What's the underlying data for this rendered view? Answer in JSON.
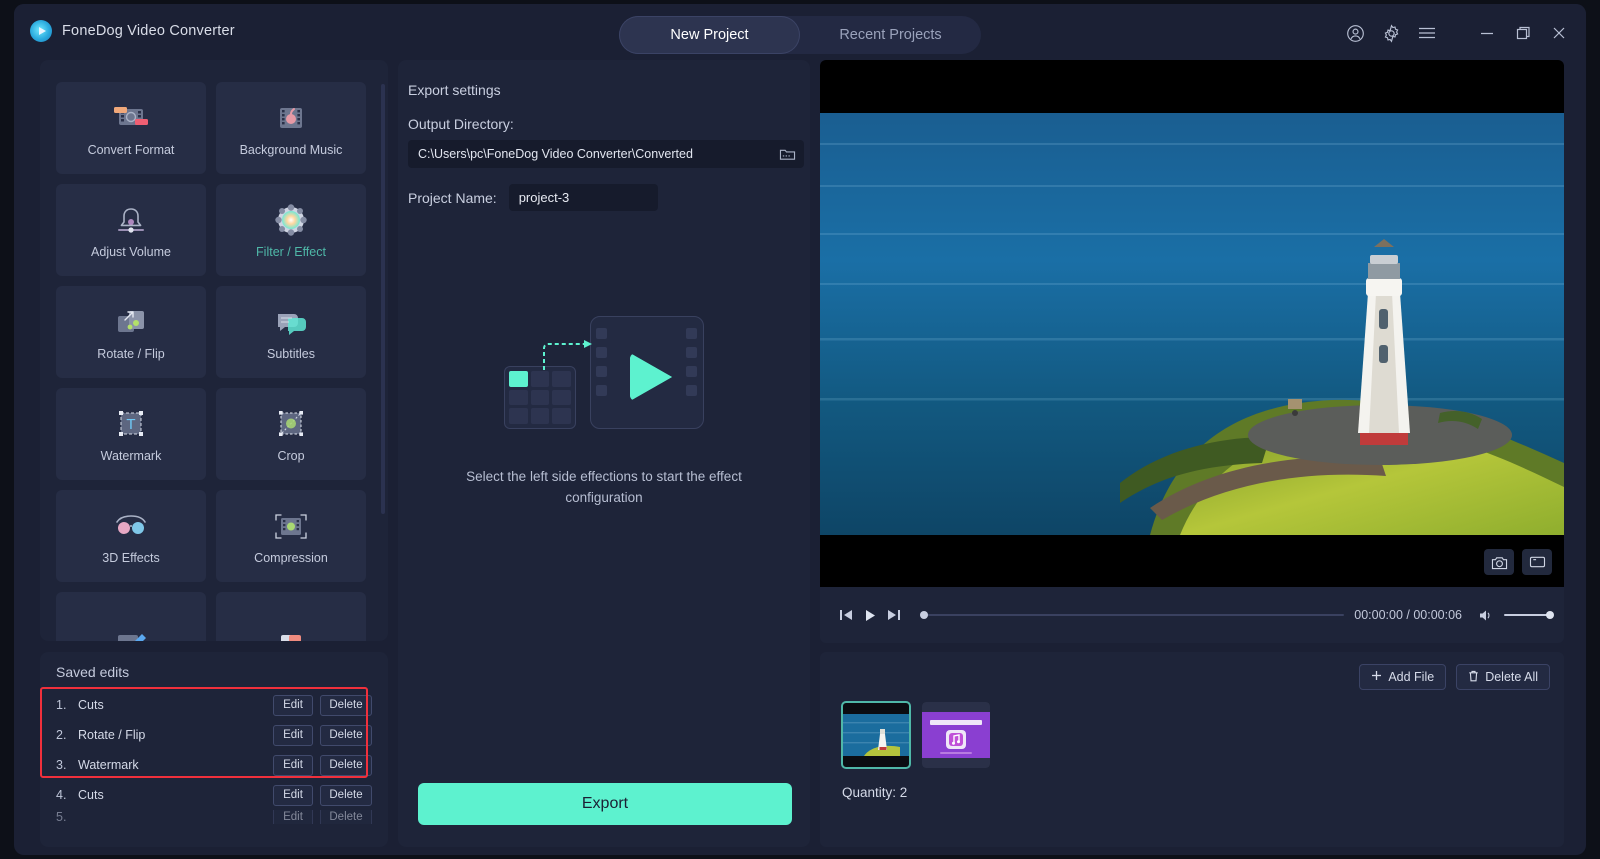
{
  "app": {
    "title": "FoneDog Video Converter",
    "logo_icon": "play-circle-logo"
  },
  "titlebar": {
    "tabs": [
      {
        "label": "New Project",
        "active": true
      },
      {
        "label": "Recent Projects",
        "active": false
      }
    ],
    "window_icons": [
      {
        "name": "account-icon"
      },
      {
        "name": "gear-icon"
      },
      {
        "name": "hamburger-menu-icon"
      },
      {
        "name": "minimize-icon"
      },
      {
        "name": "maximize-icon"
      },
      {
        "name": "close-icon"
      }
    ]
  },
  "tools": {
    "items": [
      {
        "label": "Convert Format",
        "icon": "convert-format-icon",
        "active": false
      },
      {
        "label": "Background Music",
        "icon": "background-music-icon",
        "active": false
      },
      {
        "label": "Adjust Volume",
        "icon": "adjust-volume-icon",
        "active": false
      },
      {
        "label": "Filter / Effect",
        "icon": "filter-effect-icon",
        "active": true
      },
      {
        "label": "Rotate / Flip",
        "icon": "rotate-flip-icon",
        "active": false
      },
      {
        "label": "Subtitles",
        "icon": "subtitles-icon",
        "active": false
      },
      {
        "label": "Watermark",
        "icon": "watermark-icon",
        "active": false
      },
      {
        "label": "Crop",
        "icon": "crop-icon",
        "active": false
      },
      {
        "label": "3D Effects",
        "icon": "3d-effects-icon",
        "active": false
      },
      {
        "label": "Compression",
        "icon": "compression-icon",
        "active": false
      }
    ]
  },
  "saved_edits": {
    "title": "Saved edits",
    "edit_label": "Edit",
    "delete_label": "Delete",
    "rows": [
      {
        "num": "1.",
        "name": "Cuts"
      },
      {
        "num": "2.",
        "name": "Rotate / Flip"
      },
      {
        "num": "3.",
        "name": "Watermark"
      },
      {
        "num": "4.",
        "name": "Cuts"
      }
    ],
    "highlight_color": "#f0303c"
  },
  "export_settings": {
    "title": "Export settings",
    "output_directory_label": "Output Directory:",
    "output_directory_value": "C:\\Users\\pc\\FoneDog Video Converter\\Converted",
    "folder_icon": "folder-browse-icon",
    "project_name_label": "Project Name:",
    "project_name_value": "project-3",
    "placeholder_text": "Select the left side effections to start the effect configuration",
    "placeholder_icon": "effects-placeholder-illustration",
    "export_button_label": "Export",
    "accent_color": "#5df2cf"
  },
  "preview": {
    "screenshot_icon": "camera-snapshot-icon",
    "crop_preview_icon": "aspect-ratio-icon",
    "controls": {
      "prev_icon": "skip-previous-icon",
      "play_icon": "play-icon",
      "next_icon": "skip-next-icon",
      "timecode": "00:00:00 / 00:00:06",
      "volume_icon": "volume-icon",
      "seek_position_percent": 0,
      "volume_percent": 100
    }
  },
  "files": {
    "add_file_label": "Add File",
    "add_file_icon": "plus-icon",
    "delete_all_label": "Delete All",
    "delete_all_icon": "trash-icon",
    "quantity_label": "Quantity: 2",
    "thumbnails": [
      {
        "name": "lighthouse-video-thumbnail",
        "selected": true
      },
      {
        "name": "music-file-thumbnail",
        "selected": false
      }
    ]
  }
}
